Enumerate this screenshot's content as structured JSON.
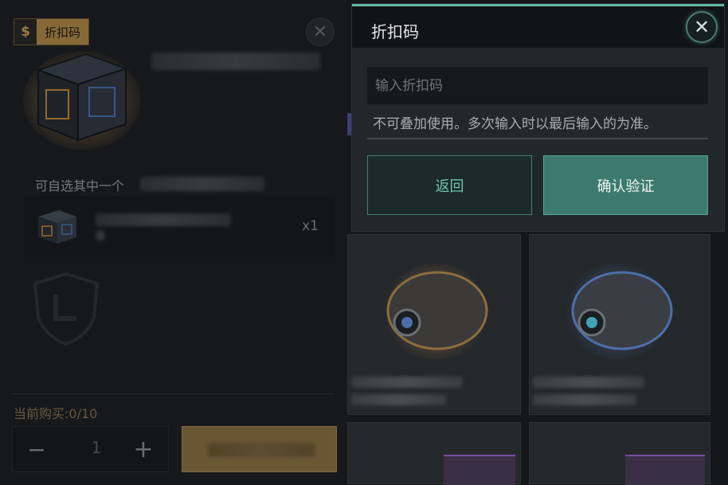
{
  "left_panel": {
    "currency_symbol": "$",
    "discount_tag_label": "折扣码",
    "choose_text": "可自选其中一个",
    "item_quantity": "x1",
    "purchase_count_label": "当前购买:0/10",
    "stepper": {
      "minus": "−",
      "value": "1",
      "plus": "+"
    }
  },
  "dialog": {
    "title": "折扣码",
    "close_icon": "close-icon",
    "input_placeholder": "输入折扣码",
    "note": "不可叠加使用。多次输入时以最后输入的为准。",
    "back_label": "返回",
    "confirm_label": "确认验证",
    "accent_color": "#5fb8a6"
  }
}
